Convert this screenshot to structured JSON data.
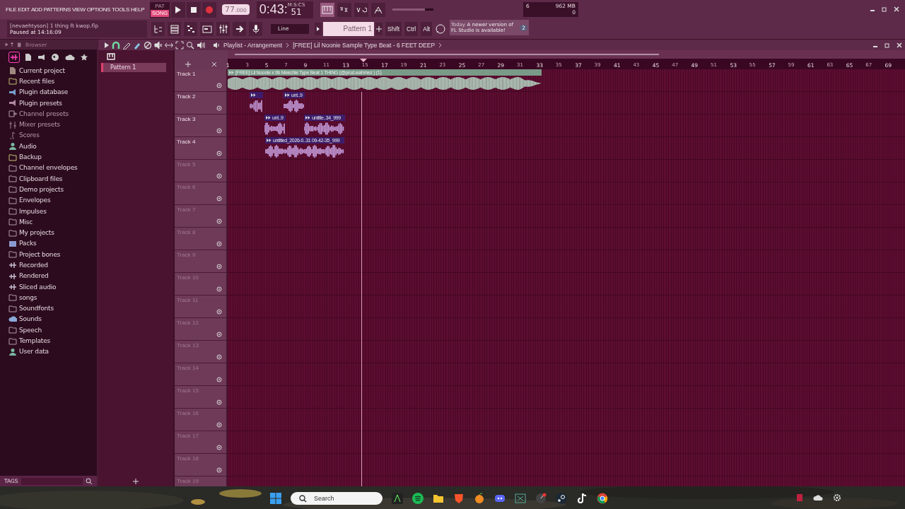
{
  "menu": [
    "FILE",
    "EDIT",
    "ADD",
    "PATTERNS",
    "VIEW",
    "OPTIONS",
    "TOOLS",
    "HELP"
  ],
  "mode": [
    {
      "label": "PAT",
      "selected": false
    },
    {
      "label": "SONG",
      "selected": true
    }
  ],
  "tempo": {
    "whole": "77",
    "fraction": ".000"
  },
  "time": {
    "value": "0:43:",
    "sub": "51",
    "unit": "M:S:CS"
  },
  "master_volume": {
    "level": 0.8
  },
  "cpu": {
    "cores": "6",
    "memory": "962 MB",
    "polyphony": "0"
  },
  "project": {
    "file": "[nevaehtyson] 1 thing ft kwop.flp",
    "status": "Paused at 14:16:09"
  },
  "snap": "Line",
  "pattern": "Pattern 1",
  "modifiers": [
    "Shift",
    "Ctrl",
    "Alt"
  ],
  "hint": {
    "when": "Today",
    "text": "A newer version of FL Studio is available!",
    "count": "2"
  },
  "browser": {
    "title": "Browser",
    "tags": "TAGS",
    "items": [
      {
        "label": "Current project",
        "kind": "project"
      },
      {
        "label": "Recent files",
        "kind": "recent"
      },
      {
        "label": "Plugin database",
        "kind": "plugin"
      },
      {
        "label": "Plugin presets",
        "kind": "plugin"
      },
      {
        "label": "Channel presets",
        "kind": "channel"
      },
      {
        "label": "Mixer presets",
        "kind": "mixer"
      },
      {
        "label": "Scores",
        "kind": "score"
      },
      {
        "label": "Audio",
        "kind": "user"
      },
      {
        "label": "Backup",
        "kind": "recent"
      },
      {
        "label": "Channel envelopes",
        "kind": "folder"
      },
      {
        "label": "Clipboard files",
        "kind": "folder"
      },
      {
        "label": "Demo projects",
        "kind": "folder"
      },
      {
        "label": "Envelopes",
        "kind": "folder"
      },
      {
        "label": "Impulses",
        "kind": "folder"
      },
      {
        "label": "Misc",
        "kind": "folder"
      },
      {
        "label": "My projects",
        "kind": "folder"
      },
      {
        "label": "Packs",
        "kind": "packs"
      },
      {
        "label": "Project bones",
        "kind": "folder"
      },
      {
        "label": "Recorded",
        "kind": "audio"
      },
      {
        "label": "Rendered",
        "kind": "audio"
      },
      {
        "label": "Sliced audio",
        "kind": "audio"
      },
      {
        "label": "songs",
        "kind": "folder"
      },
      {
        "label": "Soundfonts",
        "kind": "folder"
      },
      {
        "label": "Sounds",
        "kind": "cloud"
      },
      {
        "label": "Speech",
        "kind": "folder"
      },
      {
        "label": "Templates",
        "kind": "folder"
      },
      {
        "label": "User data",
        "kind": "user"
      }
    ]
  },
  "patterns": [
    {
      "name": "Pattern 1",
      "selected": true
    }
  ],
  "playlist": {
    "title": "Playlist - Arrangement",
    "song": "[FREE] Lil Noonie Sample Type Beat - 6 FEET DEEP",
    "ruler": [
      "1",
      "3",
      "5",
      "7",
      "9",
      "11",
      "13",
      "15",
      "17",
      "19",
      "21",
      "23",
      "25",
      "27",
      "29",
      "31",
      "33",
      "35",
      "37",
      "39",
      "41",
      "43",
      "45",
      "47",
      "49",
      "51",
      "53",
      "55",
      "57",
      "59",
      "61",
      "63",
      "65",
      "67",
      "69"
    ],
    "tracks": [
      {
        "name": "Track 1",
        "empty": false,
        "clips": [
          {
            "label": "[FREE] Lil Noonie x 9b Meechie Type Beat 1 THING (@prod.wahmez ) (1)",
            "color": "#7a9a88"
          }
        ]
      },
      {
        "name": "Track 2",
        "empty": false,
        "clips": [
          {
            "color": "#3d1d6b"
          },
          {
            "label": "unt..9",
            "color": "#3d1d6b"
          }
        ]
      },
      {
        "name": "Track 3",
        "empty": false,
        "clips": [
          {
            "label": "unt..9",
            "color": "#3d1d6b"
          },
          {
            "label": "untitle..34_999",
            "color": "#3d1d6b"
          }
        ]
      },
      {
        "name": "Track 4",
        "empty": false,
        "clips": [
          {
            "label": "untitled_2026-0..31 09-42-35_999",
            "color": "#3d1d6b"
          }
        ]
      },
      {
        "name": "Track 5",
        "empty": true
      },
      {
        "name": "Track 6",
        "empty": true
      },
      {
        "name": "Track 7",
        "empty": true
      },
      {
        "name": "Track 8",
        "empty": true
      },
      {
        "name": "Track 9",
        "empty": true
      },
      {
        "name": "Track 10",
        "empty": true
      },
      {
        "name": "Track 11",
        "empty": true
      },
      {
        "name": "Track 12",
        "empty": true
      },
      {
        "name": "Track 13",
        "empty": true
      },
      {
        "name": "Track 14",
        "empty": true
      },
      {
        "name": "Track 15",
        "empty": true
      },
      {
        "name": "Track 16",
        "empty": true
      },
      {
        "name": "Track 17",
        "empty": true
      },
      {
        "name": "Track 18",
        "empty": true
      },
      {
        "name": "Track 19",
        "empty": true
      }
    ]
  },
  "taskbar": {
    "search": "Search"
  }
}
